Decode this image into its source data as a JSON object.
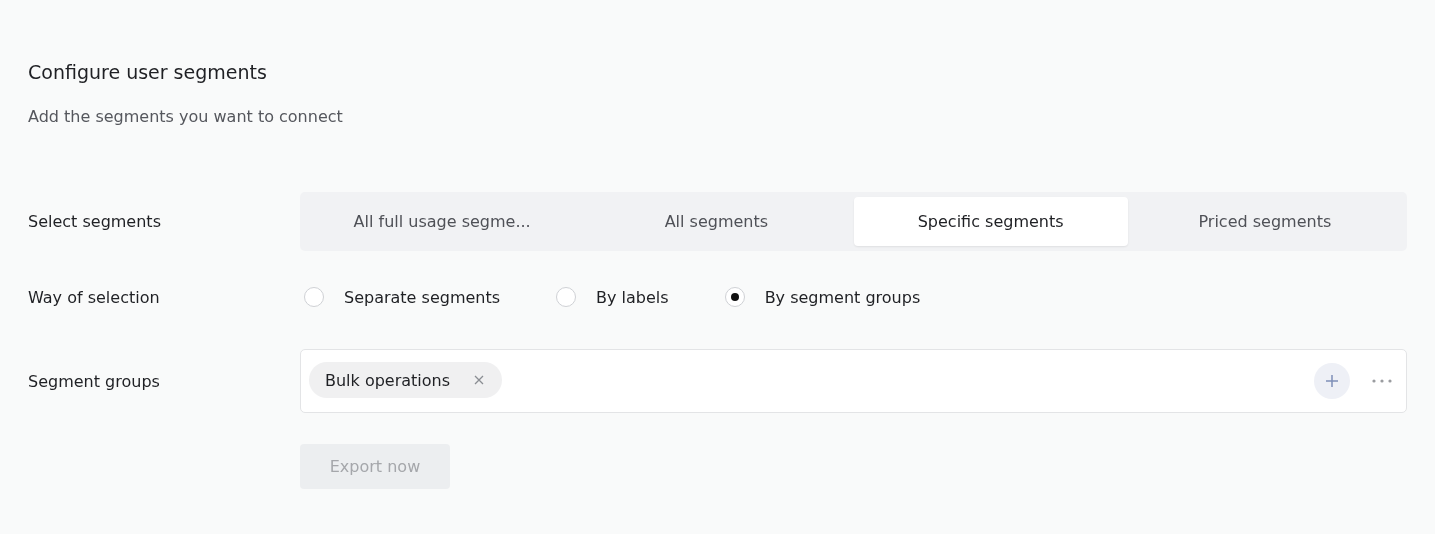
{
  "title": "Configure user segments",
  "subtitle": "Add the segments you want to connect",
  "select_segments": {
    "label": "Select segments",
    "tabs": [
      {
        "label": "All full usage segme...",
        "selected": false
      },
      {
        "label": "All segments",
        "selected": false
      },
      {
        "label": "Specific segments",
        "selected": true
      },
      {
        "label": "Priced segments",
        "selected": false
      }
    ]
  },
  "way_of_selection": {
    "label": "Way of selection",
    "options": [
      {
        "label": "Separate segments",
        "selected": false
      },
      {
        "label": "By labels",
        "selected": false
      },
      {
        "label": "By segment groups",
        "selected": true
      }
    ]
  },
  "segment_groups": {
    "label": "Segment groups",
    "tags": [
      {
        "label": "Bulk operations"
      }
    ]
  },
  "export_button": {
    "label": "Export now",
    "disabled": true
  }
}
